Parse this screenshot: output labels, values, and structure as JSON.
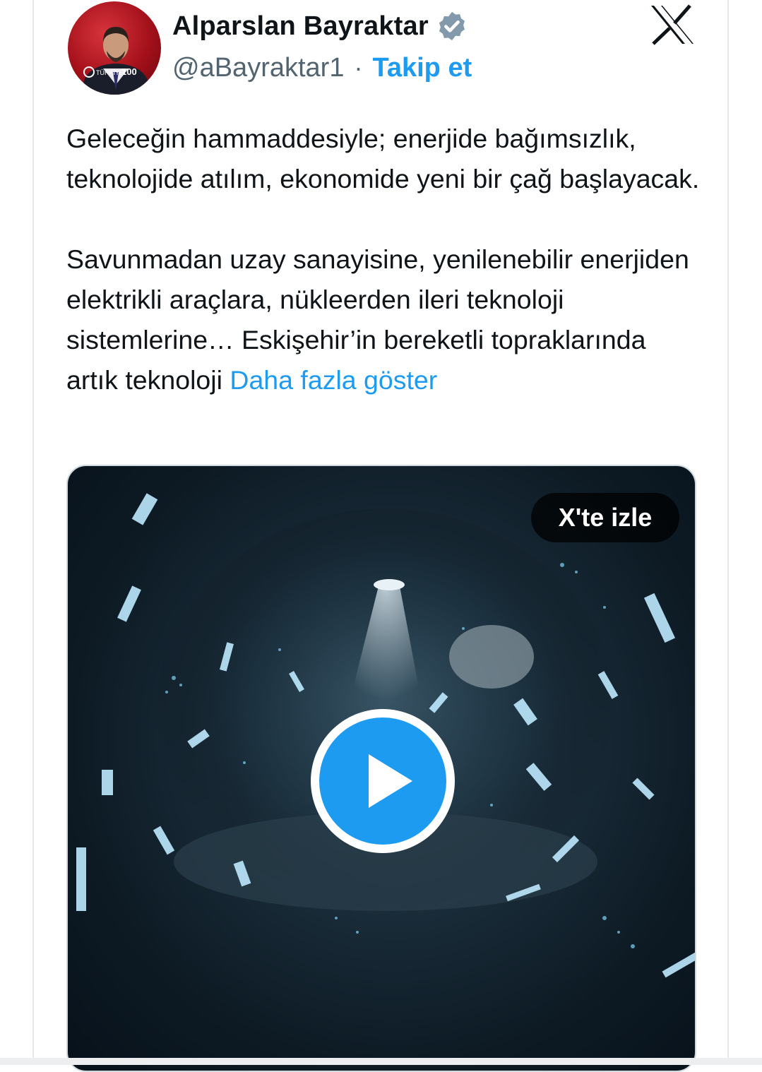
{
  "author": {
    "name": "Alparslan Bayraktar",
    "handle": "@aBayraktar1",
    "separator": "·",
    "follow_label": "Takip et",
    "verified_icon": "verified-badge-icon",
    "avatar_badge": "100"
  },
  "platform_logo": "x-logo-icon",
  "tweet": {
    "paragraph1": "Geleceğin hammaddesiyle; enerjide bağımsızlık, teknolojide atılım, ekonomide yeni bir çağ başlayacak.",
    "paragraph2": "Savunmadan uzay sanayisine, yenilenebilir enerjiden elektrikli araçlara, nükleerden ileri teknoloji sistemlerine… Eskişehir’in bereketli topraklarında artık teknoloji ",
    "show_more": "Daha fazla göster"
  },
  "media": {
    "watch_label": "X'te izle",
    "play_icon": "play-icon"
  },
  "colors": {
    "accent": "#1d9bf0",
    "text": "#0f1419",
    "muted": "#536471",
    "verified": "#829aab"
  }
}
